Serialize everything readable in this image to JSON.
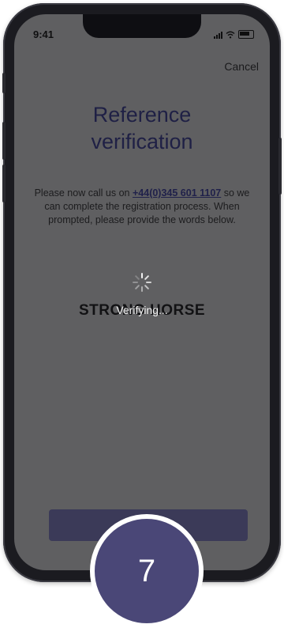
{
  "status_bar": {
    "time": "9:41"
  },
  "header": {
    "cancel_label": "Cancel"
  },
  "main": {
    "title_line1": "Reference",
    "title_line2": "verification",
    "instructions_prefix": "Please now call us on ",
    "phone_number": "+44(0)345 601 1107",
    "instructions_suffix": " so we can complete the registration process. When prompted, please provide the words below.",
    "words": "STRONG HORSE"
  },
  "loading": {
    "label": "Verifying..."
  },
  "step": {
    "number": "7"
  },
  "colors": {
    "screen_dim": "#5f5f61",
    "title": "#1f2045",
    "badge": "#4a4777",
    "button": "#3b3a58"
  }
}
